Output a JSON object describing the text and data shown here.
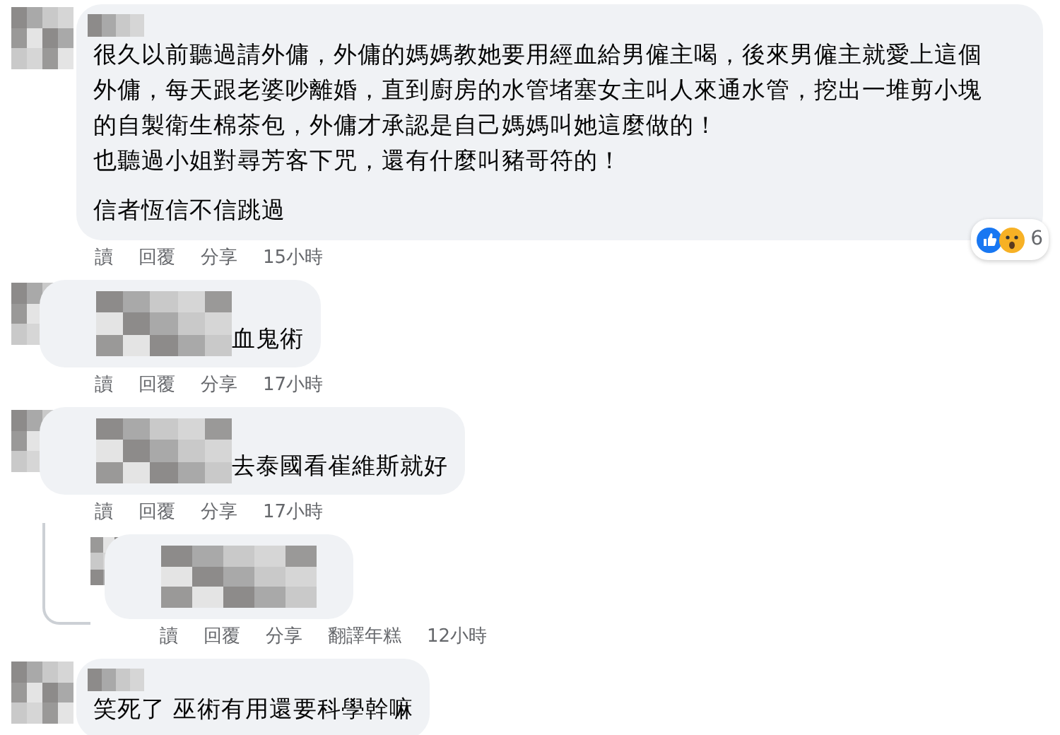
{
  "comments": [
    {
      "kind": "comment",
      "paragraphs": [
        [
          "很久以前聽過請外傭，外傭的媽媽教她要用經血給男僱主喝，後來男僱主就愛上這個外傭，每天跟老婆吵離婚，直到廚房的水管堵塞女主叫人來通水管，挖出一堆剪小塊的自製衛生棉茶包，外傭才承認是自己媽媽叫她這麼做的！",
          "也聽過小姐對尋芳客下咒，還有什麼叫豬哥符的！"
        ],
        [
          "信者恆信不信跳過"
        ]
      ],
      "actions": [
        "讀",
        "回覆",
        "分享"
      ],
      "time": "15小時",
      "reactions": {
        "count": "6"
      }
    },
    {
      "kind": "inline",
      "paragraphs": [
        [
          "血鬼術"
        ]
      ],
      "actions": [
        "讀",
        "回覆",
        "分享"
      ],
      "time": "17小時"
    },
    {
      "kind": "inline",
      "paragraphs": [
        [
          "去泰國看崔維斯就好"
        ]
      ],
      "actions": [
        "讀",
        "回覆",
        "分享"
      ],
      "time": "17小時",
      "children": [
        {
          "kind": "hidden",
          "actions": [
            "讀",
            "回覆",
            "分享",
            "翻譯年糕"
          ],
          "time": "12小時"
        }
      ]
    },
    {
      "kind": "comment",
      "paragraphs": [
        [
          "笑死了 巫術有用還要科學幹嘛"
        ]
      ]
    }
  ]
}
